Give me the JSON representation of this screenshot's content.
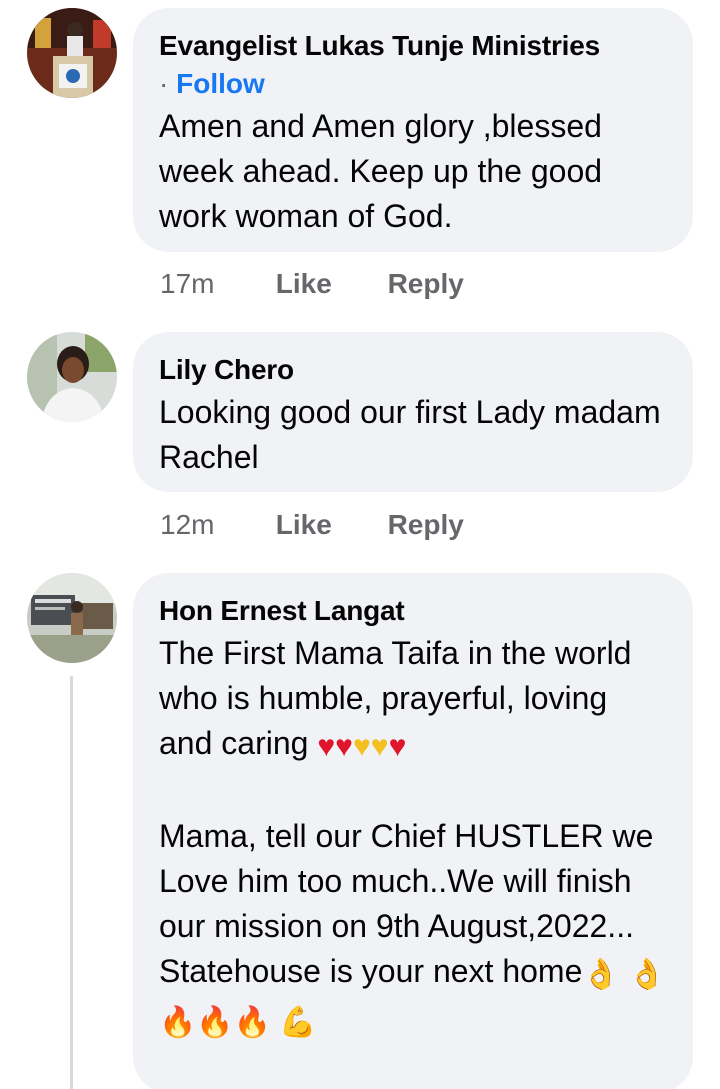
{
  "comments": [
    {
      "author": "Evangelist  Lukas Tunje Ministries",
      "follow_dot": "·",
      "follow_label": "Follow",
      "text": "Amen and Amen glory ,blessed week ahead. Keep up the good work woman of God.",
      "time": "17m",
      "like_label": "Like",
      "reply_label": "Reply"
    },
    {
      "author": "Lily Chero",
      "text": "Looking good our first Lady madam Rachel",
      "time": "12m",
      "like_label": "Like",
      "reply_label": "Reply"
    },
    {
      "author": "Hon Ernest Langat",
      "text_line1": "The First Mama Taifa in the world who is humble, prayerful, loving and caring",
      "emojis_line1": "♥♥♥♥♥",
      "text_para2": "Mama, tell our Chief HUSTLER we Love him too much..We will finish our mission on 9th August,2022... Statehouse is your next home",
      "emojis_para2": "👌👌🔥🔥🔥💪"
    }
  ],
  "colors": {
    "bubble_bg": "#f0f2f5",
    "follow_blue": "#1877f2",
    "meta_gray": "#65676b"
  }
}
